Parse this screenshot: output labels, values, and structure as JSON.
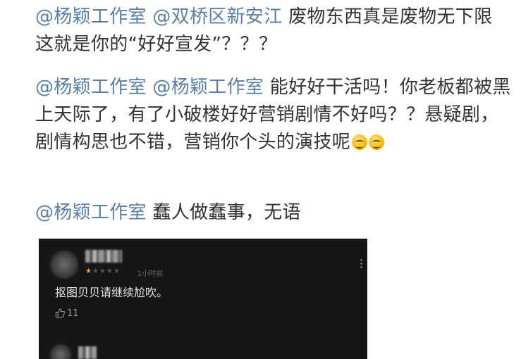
{
  "comments": [
    {
      "mentions": [
        "@杨颖工作室",
        "@双桥区新安江"
      ],
      "text": "废物东西真是废物无下限 这就是你的“好好宣发”？？？"
    },
    {
      "mentions": [
        "@杨颖工作室",
        "@杨颖工作室"
      ],
      "text": "能好好干活吗！你老板都被黑上天际了，有了小破楼好好营销剧情不好吗？？悬疑剧，剧情构思也不错，营销你个头的演技呢",
      "emoji": [
        "smirk-face-emoji",
        "smirk-face-emoji"
      ]
    },
    {
      "mentions": [
        "@杨颖工作室"
      ],
      "text": "蠢人做蠢事，无语"
    }
  ],
  "screenshot": {
    "rating": 1,
    "rating_max": 5,
    "time": "1小时前",
    "review_text": "抠图贝贝请继续尬吹。",
    "likes": "11",
    "icons": [
      "thumbs-up-icon",
      "more-vertical-icon"
    ],
    "colors": {
      "background": "#161616",
      "star": "#f5a623"
    }
  },
  "colors": {
    "mention": "#5a7fa6",
    "text": "#333333"
  }
}
